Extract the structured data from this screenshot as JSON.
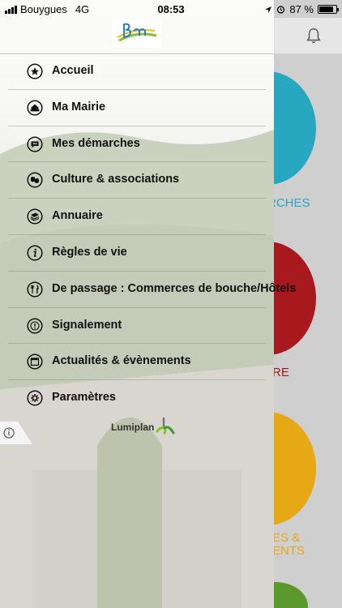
{
  "status_bar": {
    "carrier": "Bouygues",
    "network": "4G",
    "time": "08:53",
    "battery": "87 %",
    "battery_level": 0.87
  },
  "menu": {
    "items": [
      {
        "label": "Accueil",
        "icon": "star-icon"
      },
      {
        "label": "Ma Mairie",
        "icon": "townhall-icon"
      },
      {
        "label": "Mes démarches",
        "icon": "chat-icon"
      },
      {
        "label": "Culture & associations",
        "icon": "masks-icon"
      },
      {
        "label": "Annuaire",
        "icon": "book-icon"
      },
      {
        "label": "Règles de vie",
        "icon": "info-icon"
      },
      {
        "label": "De passage : Commerces de bouche/Hôtels",
        "icon": "fork-knife-icon"
      },
      {
        "label": "Signalement",
        "icon": "alert-icon"
      },
      {
        "label": "Actualités & évènements",
        "icon": "calendar-icon"
      },
      {
        "label": "Paramètres",
        "icon": "settings-icon"
      }
    ]
  },
  "footer": {
    "brand": "Lumiplan"
  },
  "background_tiles": {
    "tile1_label": "RCHES",
    "tile2_label": "RE",
    "tile3_label_line1": "ES &",
    "tile3_label_line2": "ENTS"
  },
  "colors": {
    "tile1": "#27a7c0",
    "tile2": "#a8191e",
    "tile3": "#e7a815",
    "tile4": "#5a9a2c"
  }
}
